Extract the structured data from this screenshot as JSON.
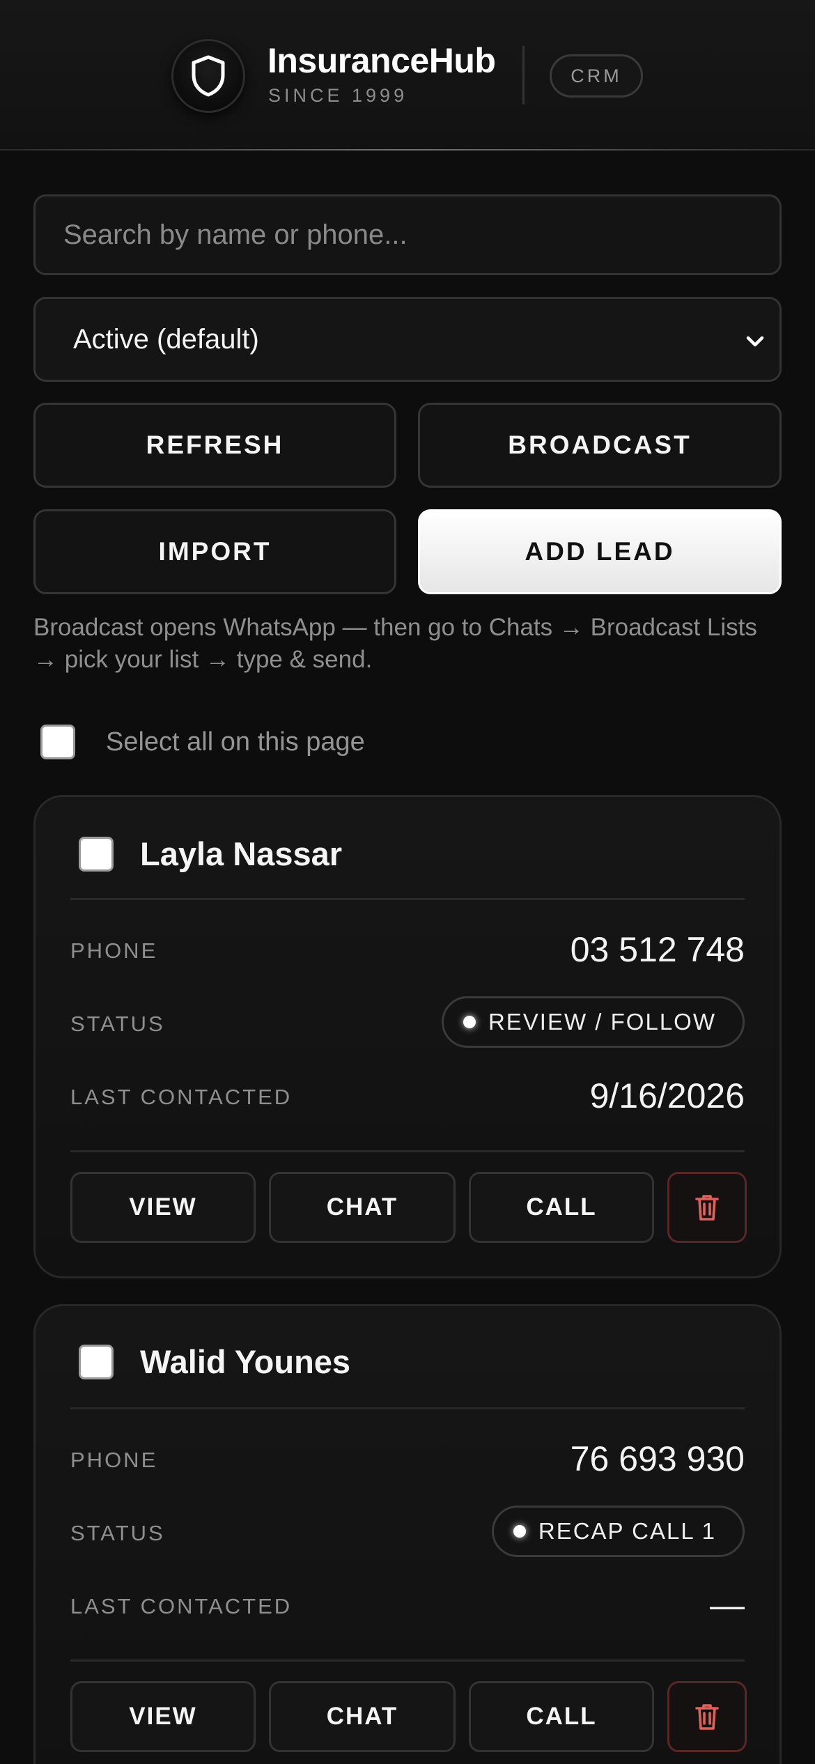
{
  "header": {
    "brand_name": "InsuranceHub",
    "since": "SINCE 1999",
    "badge": "CRM",
    "logo_icon": "shield-icon"
  },
  "search": {
    "placeholder": "Search by name or phone...",
    "value": ""
  },
  "filter": {
    "selected": "Active (default)",
    "icon": "chevron-down-icon"
  },
  "actions": {
    "refresh": "REFRESH",
    "broadcast": "BROADCAST",
    "import": "IMPORT",
    "add_lead": "ADD LEAD"
  },
  "hint": "Broadcast opens WhatsApp — then go to Chats → Broadcast Lists → pick your list → type & send.",
  "select_all": {
    "label": "Select all on this page",
    "checked": false
  },
  "field_labels": {
    "phone": "PHONE",
    "status": "STATUS",
    "last_contacted": "LAST CONTACTED"
  },
  "card_actions": {
    "view": "VIEW",
    "chat": "CHAT",
    "call": "CALL",
    "delete_icon": "trash-icon"
  },
  "leads": [
    {
      "name": "Layla Nassar",
      "phone": "03 512 748",
      "status": "REVIEW / FOLLOW",
      "last_contacted": "9/16/2026",
      "checked": false
    },
    {
      "name": "Walid Younes",
      "phone": "76 693 930",
      "status": "RECAP CALL 1",
      "last_contacted": "—",
      "checked": false
    }
  ],
  "colors": {
    "background": "#0d0d0d",
    "primary_button": "#ffffff",
    "danger": "#e0605a"
  }
}
